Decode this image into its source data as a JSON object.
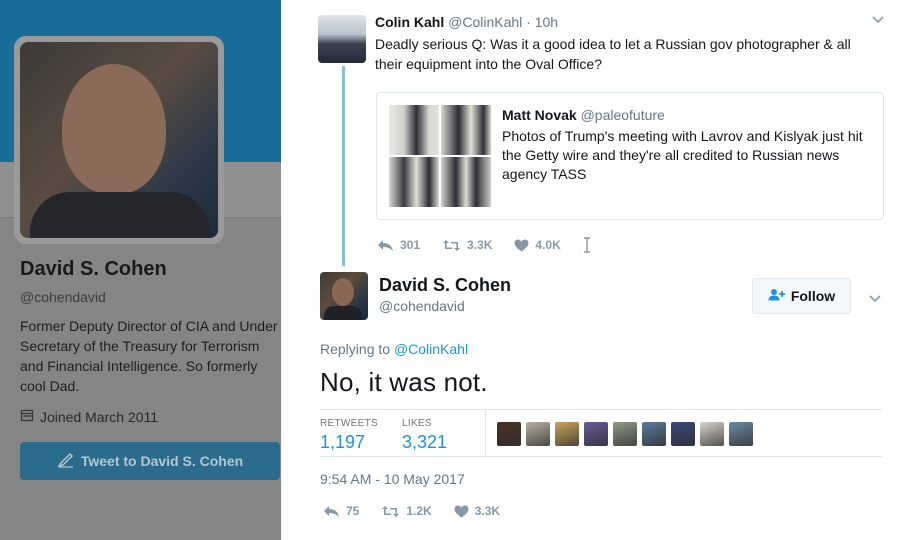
{
  "profile": {
    "name": "David S. Cohen",
    "handle": "@cohendavid",
    "bio": "Former Deputy Director of CIA and Under Secretary of the Treasury for Terrorism and Financial Intelligence. So formerly cool Dad.",
    "joined": "Joined March 2011",
    "tweet_to_label": "Tweet to David S. Cohen",
    "header_color": "#1b6d99"
  },
  "parent_tweet": {
    "name": "Colin Kahl",
    "handle": "@ColinKahl",
    "time": "· 10h",
    "text": "Deadly serious Q: Was it a good idea to let a Russian gov photographer & all their equipment into the Oval Office?",
    "quote": {
      "name": "Matt Novak",
      "handle": "@paleofuture",
      "text": "Photos of Trump's meeting with Lavrov and Kislyak just hit the Getty wire and they're all credited to Russian news agency TASS"
    },
    "actions": {
      "replies": "301",
      "retweets": "3.3K",
      "likes": "4.0K"
    }
  },
  "main_tweet": {
    "name": "David S. Cohen",
    "handle": "@cohendavid",
    "follow_label": "Follow",
    "replying_prefix": "Replying to",
    "replying_to": "@ColinKahl",
    "text": "No, it was not.",
    "stats": {
      "retweets_label": "RETWEETS",
      "retweets": "1,197",
      "likes_label": "LIKES",
      "likes": "3,321"
    },
    "liker_colors": [
      "#4a3426",
      "#b8b0a0",
      "#c9a45c",
      "#6a5a9a",
      "#8f9a88",
      "#5a7a9a",
      "#3a4a7a",
      "#d8d4cc",
      "#6d8aa6"
    ],
    "timestamp": "9:54 AM - 10 May 2017",
    "actions": {
      "replies": "75",
      "retweets": "1.2K",
      "likes": "3.3K"
    }
  },
  "colors": {
    "link": "#1b95e0",
    "muted": "#657786",
    "thread_line": "#87c3cf"
  }
}
